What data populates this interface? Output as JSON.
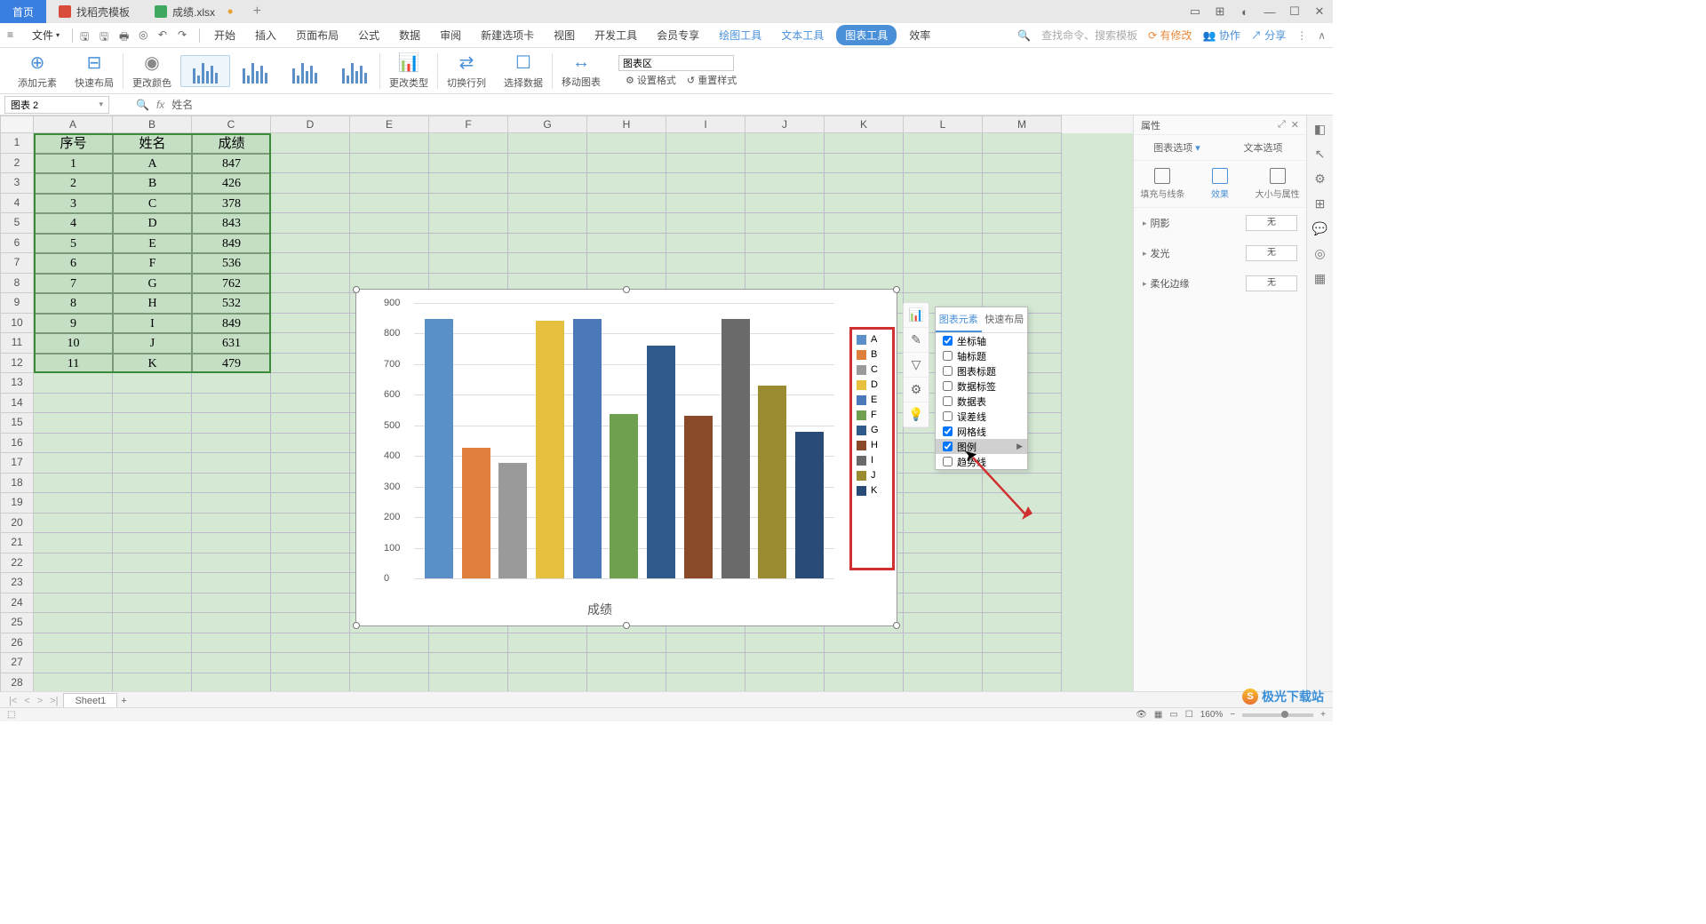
{
  "titlebar": {
    "tab_home": "首页",
    "tab_template": "找稻壳模板",
    "tab_file": "成绩.xlsx"
  },
  "menu": {
    "file": "文件",
    "tabs": [
      "开始",
      "插入",
      "页面布局",
      "公式",
      "数据",
      "审阅",
      "新建选项卡",
      "视图",
      "开发工具",
      "会员专享",
      "绘图工具",
      "文本工具",
      "图表工具",
      "效率"
    ],
    "search_cmd": "查找命令、搜索模板",
    "has_changes": "有修改",
    "collab": "协作",
    "share": "分享"
  },
  "ribbon": {
    "add_element": "添加元素",
    "quick_layout": "快速布局",
    "change_color": "更改颜色",
    "change_type": "更改类型",
    "switch_rowcol": "切换行列",
    "select_data": "选择数据",
    "move_chart": "移动图表",
    "chart_area": "图表区",
    "set_format": "设置格式",
    "reset_style": "重置样式"
  },
  "formula": {
    "name_box": "图表 2",
    "fx_value": "姓名"
  },
  "columns": [
    "A",
    "B",
    "C",
    "D",
    "E",
    "F",
    "G",
    "H",
    "I",
    "J",
    "K",
    "L",
    "M"
  ],
  "table": {
    "headers": [
      "序号",
      "姓名",
      "成绩"
    ],
    "rows": [
      [
        "1",
        "A",
        "847"
      ],
      [
        "2",
        "B",
        "426"
      ],
      [
        "3",
        "C",
        "378"
      ],
      [
        "4",
        "D",
        "843"
      ],
      [
        "5",
        "E",
        "849"
      ],
      [
        "6",
        "F",
        "536"
      ],
      [
        "7",
        "G",
        "762"
      ],
      [
        "8",
        "H",
        "532"
      ],
      [
        "9",
        "I",
        "849"
      ],
      [
        "10",
        "J",
        "631"
      ],
      [
        "11",
        "K",
        "479"
      ]
    ]
  },
  "chart_data": {
    "type": "bar",
    "categories": [
      "A",
      "B",
      "C",
      "D",
      "E",
      "F",
      "G",
      "H",
      "I",
      "J",
      "K"
    ],
    "values": [
      847,
      426,
      378,
      843,
      849,
      536,
      762,
      532,
      849,
      631,
      479
    ],
    "colors": [
      "#5b8fc7",
      "#df7f3c",
      "#9a9a9a",
      "#e8c040",
      "#4a78b8",
      "#6fa050",
      "#2f5a8a",
      "#8a4a2a",
      "#6a6a6a",
      "#9a8a30",
      "#2a4a78"
    ],
    "title": "成绩",
    "ylabel": "",
    "xlabel": "成绩",
    "ylim": [
      0,
      900
    ],
    "yticks": [
      0,
      100,
      200,
      300,
      400,
      500,
      600,
      700,
      800,
      900
    ],
    "legend": [
      "A",
      "B",
      "C",
      "D",
      "E",
      "F",
      "G",
      "H",
      "I",
      "J",
      "K"
    ]
  },
  "chart_side_tools": [
    "⫿",
    "✎",
    "▽",
    "⚙",
    "✦"
  ],
  "chart_elements_popup": {
    "tab1": "图表元素",
    "tab2": "快速布局",
    "options": [
      {
        "label": "坐标轴",
        "checked": true,
        "hl": false
      },
      {
        "label": "轴标题",
        "checked": false,
        "hl": false
      },
      {
        "label": "图表标题",
        "checked": false,
        "hl": false
      },
      {
        "label": "数据标签",
        "checked": false,
        "hl": false
      },
      {
        "label": "数据表",
        "checked": false,
        "hl": false
      },
      {
        "label": "误差线",
        "checked": false,
        "hl": false
      },
      {
        "label": "网格线",
        "checked": true,
        "hl": false
      },
      {
        "label": "图例",
        "checked": true,
        "hl": true,
        "arrow": true
      },
      {
        "label": "趋势线",
        "checked": false,
        "hl": false
      }
    ]
  },
  "props": {
    "title": "属性",
    "tab_chart_opts": "图表选项",
    "tab_text_opts": "文本选项",
    "sub_fill": "填充与线条",
    "sub_effect": "效果",
    "sub_size": "大小与属性",
    "row_shadow": "阴影",
    "row_glow": "发光",
    "row_soft": "柔化边缘",
    "val_none": "无"
  },
  "sheet": {
    "name": "Sheet1"
  },
  "status": {
    "zoom": "160%"
  },
  "watermark": "极光下载站"
}
